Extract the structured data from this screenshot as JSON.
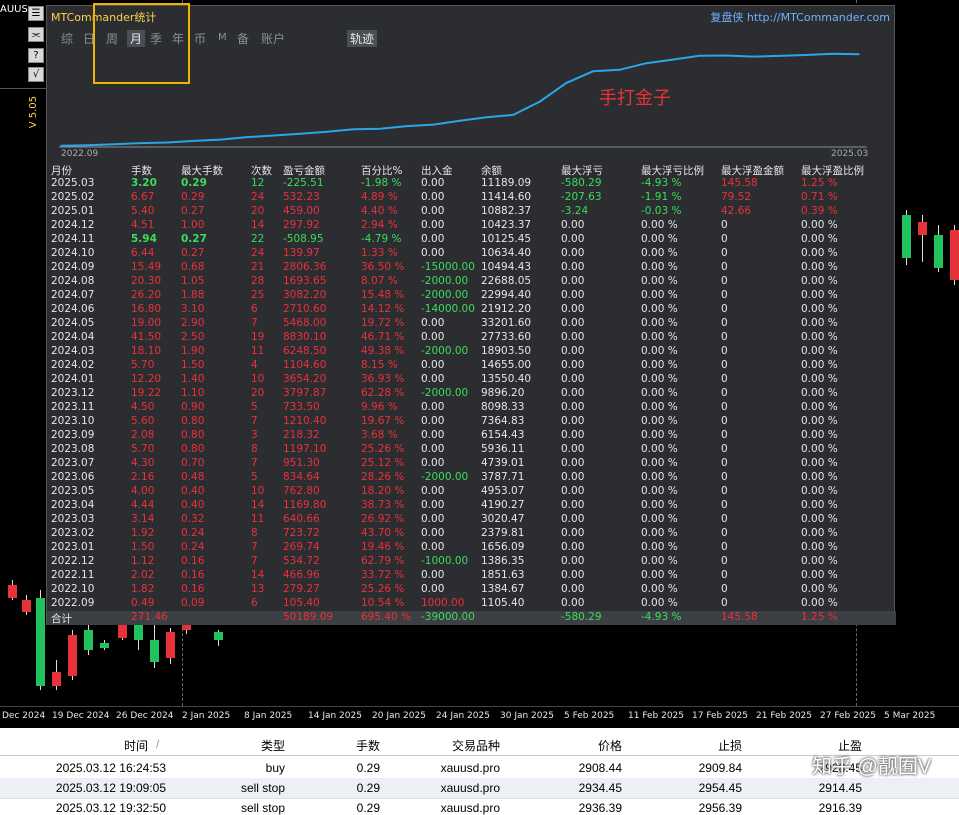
{
  "chart": {
    "symbol": "AUUS",
    "price_side_label": "V 5.05",
    "toolbar": [
      "☰",
      "⫘",
      "?",
      "√"
    ],
    "time_axis": [
      "Dec 2024",
      "19 Dec 2024",
      "26 Dec 2024",
      "2 Jan 2025",
      "8 Jan 2025",
      "14 Jan 2025",
      "20 Jan 2025",
      "24 Jan 2025",
      "30 Jan 2025",
      "5 Feb 2025",
      "11 Feb 2025",
      "17 Feb 2025",
      "21 Feb 2025",
      "27 Feb 2025",
      "5 Mar 2025"
    ],
    "colors": {
      "bull": "#21c25e",
      "bear": "#e8323a",
      "bg": "#000000"
    }
  },
  "window": {
    "title": "MTCommander统计",
    "site_brand": "复盘侠",
    "site_url": "http://MTCommander.com",
    "tabs": [
      "综",
      "日",
      "周",
      "月",
      "季",
      "年",
      "币",
      "M",
      "备",
      "账户"
    ],
    "active_tab": "月",
    "track_tab": "轨迹",
    "watermark": "手打金子",
    "equity_start": "2022.09",
    "equity_end": "2025.03"
  },
  "chart_data": {
    "type": "line",
    "x": [
      "2022.09",
      "2022.10",
      "2022.11",
      "2022.12",
      "2023.01",
      "2023.02",
      "2023.03",
      "2023.04",
      "2023.05",
      "2023.06",
      "2023.07",
      "2023.08",
      "2023.09",
      "2023.10",
      "2023.11",
      "2023.12",
      "2024.01",
      "2024.02",
      "2024.03",
      "2024.04",
      "2024.05",
      "2024.06",
      "2024.07",
      "2024.08",
      "2024.09",
      "2024.10",
      "2024.11",
      "2024.12",
      "2025.01",
      "2025.02",
      "2025.03"
    ],
    "y": [
      105.4,
      384.67,
      851.63,
      1386.35,
      1656.09,
      2379.81,
      3020.47,
      4190.27,
      4953.07,
      5787.71,
      6739.01,
      7936.11,
      8154.43,
      9364.83,
      10098.33,
      11896.2,
      13550.4,
      14655.0,
      20903.5,
      29733.6,
      35201.6,
      35912.2,
      38994.4,
      40688.0,
      42494.43,
      42634.0,
      42125.45,
      42423.37,
      42882.37,
      43414.6,
      43189.09
    ],
    "xlabel": "",
    "ylabel": ""
  },
  "stats": {
    "headers": [
      "月份",
      "手数",
      "最大手数",
      "次数",
      "盈亏金额",
      "百分比%",
      "出入金",
      "余额",
      "最大浮亏",
      "最大浮亏比例",
      "最大浮盈金额",
      "最大浮盈比例"
    ],
    "rows": [
      [
        "2025.03",
        "3.20",
        "0.29",
        "12",
        "-225.51",
        "-1.98 %",
        "0.00",
        "11189.09",
        "-580.29",
        "-4.93 %",
        "145.58",
        "1.25 %"
      ],
      [
        "2025.02",
        "6.67",
        "0.29",
        "24",
        "532.23",
        "4.89 %",
        "0.00",
        "11414.60",
        "-207.63",
        "-1.91 %",
        "79.52",
        "0.71 %"
      ],
      [
        "2025.01",
        "5.40",
        "0.27",
        "20",
        "459.00",
        "4.40 %",
        "0.00",
        "10882.37",
        "-3.24",
        "-0.03 %",
        "42.66",
        "0.39 %"
      ],
      [
        "2024.12",
        "4.51",
        "1.00",
        "14",
        "297.92",
        "2.94 %",
        "0.00",
        "10423.37",
        "0.00",
        "0.00 %",
        "0",
        "0.00 %"
      ],
      [
        "2024.11",
        "5.94",
        "0.27",
        "22",
        "-508.95",
        "-4.79 %",
        "0.00",
        "10125.45",
        "0.00",
        "0.00 %",
        "0",
        "0.00 %"
      ],
      [
        "2024.10",
        "6.44",
        "0.27",
        "24",
        "139.97",
        "1.33 %",
        "0.00",
        "10634.40",
        "0.00",
        "0.00 %",
        "0",
        "0.00 %"
      ],
      [
        "2024.09",
        "15.49",
        "0.68",
        "21",
        "2806.36",
        "36.50 %",
        "-15000.00",
        "10494.43",
        "0.00",
        "0.00 %",
        "0",
        "0.00 %"
      ],
      [
        "2024.08",
        "20.30",
        "1.05",
        "28",
        "1693.65",
        "8.07 %",
        "-2000.00",
        "22688.05",
        "0.00",
        "0.00 %",
        "0",
        "0.00 %"
      ],
      [
        "2024.07",
        "26.20",
        "1.88",
        "25",
        "3082.20",
        "15.48 %",
        "-2000.00",
        "22994.40",
        "0.00",
        "0.00 %",
        "0",
        "0.00 %"
      ],
      [
        "2024.06",
        "16.80",
        "3.10",
        "6",
        "2710.60",
        "14.12 %",
        "-14000.00",
        "21912.20",
        "0.00",
        "0.00 %",
        "0",
        "0.00 %"
      ],
      [
        "2024.05",
        "19.00",
        "2.90",
        "7",
        "5468.00",
        "19.72 %",
        "0.00",
        "33201.60",
        "0.00",
        "0.00 %",
        "0",
        "0.00 %"
      ],
      [
        "2024.04",
        "41.50",
        "2.50",
        "19",
        "8830.10",
        "46.71 %",
        "0.00",
        "27733.60",
        "0.00",
        "0.00 %",
        "0",
        "0.00 %"
      ],
      [
        "2024.03",
        "18.10",
        "1.90",
        "11",
        "6248.50",
        "49.38 %",
        "-2000.00",
        "18903.50",
        "0.00",
        "0.00 %",
        "0",
        "0.00 %"
      ],
      [
        "2024.02",
        "5.70",
        "1.50",
        "4",
        "1104.60",
        "8.15 %",
        "0.00",
        "14655.00",
        "0.00",
        "0.00 %",
        "0",
        "0.00 %"
      ],
      [
        "2024.01",
        "12.20",
        "1.40",
        "10",
        "3654.20",
        "36.93 %",
        "0.00",
        "13550.40",
        "0.00",
        "0.00 %",
        "0",
        "0.00 %"
      ],
      [
        "2023.12",
        "19.22",
        "1.10",
        "20",
        "3797.87",
        "62.28 %",
        "-2000.00",
        "9896.20",
        "0.00",
        "0.00 %",
        "0",
        "0.00 %"
      ],
      [
        "2023.11",
        "4.50",
        "0.90",
        "5",
        "733.50",
        "9.96 %",
        "0.00",
        "8098.33",
        "0.00",
        "0.00 %",
        "0",
        "0.00 %"
      ],
      [
        "2023.10",
        "5.60",
        "0.80",
        "7",
        "1210.40",
        "19.67 %",
        "0.00",
        "7364.83",
        "0.00",
        "0.00 %",
        "0",
        "0.00 %"
      ],
      [
        "2023.09",
        "2.08",
        "0.80",
        "3",
        "218.32",
        "3.68 %",
        "0.00",
        "6154.43",
        "0.00",
        "0.00 %",
        "0",
        "0.00 %"
      ],
      [
        "2023.08",
        "5.70",
        "0.80",
        "8",
        "1197.10",
        "25.26 %",
        "0.00",
        "5936.11",
        "0.00",
        "0.00 %",
        "0",
        "0.00 %"
      ],
      [
        "2023.07",
        "4.30",
        "0.70",
        "7",
        "951.30",
        "25.12 %",
        "0.00",
        "4739.01",
        "0.00",
        "0.00 %",
        "0",
        "0.00 %"
      ],
      [
        "2023.06",
        "2.16",
        "0.48",
        "5",
        "834.64",
        "28.26 %",
        "-2000.00",
        "3787.71",
        "0.00",
        "0.00 %",
        "0",
        "0.00 %"
      ],
      [
        "2023.05",
        "4.00",
        "0.40",
        "10",
        "762.80",
        "18.20 %",
        "0.00",
        "4953.07",
        "0.00",
        "0.00 %",
        "0",
        "0.00 %"
      ],
      [
        "2023.04",
        "4.44",
        "0.40",
        "14",
        "1169.80",
        "38.73 %",
        "0.00",
        "4190.27",
        "0.00",
        "0.00 %",
        "0",
        "0.00 %"
      ],
      [
        "2023.03",
        "3.14",
        "0.32",
        "11",
        "640.66",
        "26.92 %",
        "0.00",
        "3020.47",
        "0.00",
        "0.00 %",
        "0",
        "0.00 %"
      ],
      [
        "2023.02",
        "1.92",
        "0.24",
        "8",
        "723.72",
        "43.70 %",
        "0.00",
        "2379.81",
        "0.00",
        "0.00 %",
        "0",
        "0.00 %"
      ],
      [
        "2023.01",
        "1.50",
        "0.24",
        "7",
        "269.74",
        "19.46 %",
        "0.00",
        "1656.09",
        "0.00",
        "0.00 %",
        "0",
        "0.00 %"
      ],
      [
        "2022.12",
        "1.12",
        "0.16",
        "7",
        "534.72",
        "62.79 %",
        "-1000.00",
        "1386.35",
        "0.00",
        "0.00 %",
        "0",
        "0.00 %"
      ],
      [
        "2022.11",
        "2.02",
        "0.16",
        "14",
        "466.96",
        "33.72 %",
        "0.00",
        "1851.63",
        "0.00",
        "0.00 %",
        "0",
        "0.00 %"
      ],
      [
        "2022.10",
        "1.82",
        "0.16",
        "13",
        "279.27",
        "25.26 %",
        "0.00",
        "1384.67",
        "0.00",
        "0.00 %",
        "0",
        "0.00 %"
      ],
      [
        "2022.09",
        "0.49",
        "0.09",
        "6",
        "105.40",
        "10.54 %",
        "1000.00",
        "1105.40",
        "0.00",
        "0.00 %",
        "0",
        "0.00 %"
      ]
    ],
    "total": [
      "合计",
      "271.46",
      "",
      "",
      "50189.09",
      "695.40 %",
      "-39000.00",
      "",
      "-580.29",
      "-4.93 %",
      "145.58",
      "1.25 %"
    ]
  },
  "orders": {
    "headers": [
      "时间",
      "类型",
      "手数",
      "交易品种",
      "价格",
      "止损",
      "止盈"
    ],
    "sort_indicator": "/",
    "rows": [
      [
        "2025.03.12 16:24:53",
        "buy",
        "0.29",
        "xauusd.pro",
        "2908.44",
        "2909.84",
        "2928.45"
      ],
      [
        "2025.03.12 19:09:05",
        "sell stop",
        "0.29",
        "xauusd.pro",
        "2934.45",
        "2954.45",
        "2914.45"
      ],
      [
        "2025.03.12 19:32:50",
        "sell stop",
        "0.29",
        "xauusd.pro",
        "2936.39",
        "2956.39",
        "2916.39"
      ]
    ]
  },
  "zhihu_watermark": "知乎 @靓囿V"
}
